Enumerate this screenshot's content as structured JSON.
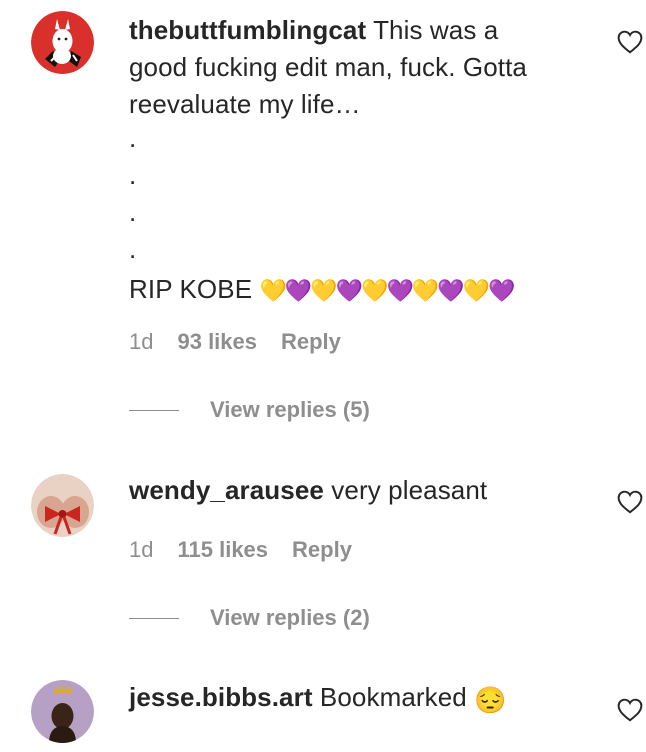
{
  "comments": [
    {
      "username": "thebuttfumblingcat",
      "text_line1": "This was a",
      "text_line2": "good fucking edit man, fuck. Gotta",
      "text_line3": "reevaluate my life…",
      "dots": [
        ".",
        ".",
        ".",
        "."
      ],
      "rip_text": "RIP KOBE",
      "hearts": "💛💜💛💜💛💜💛💜💛💜",
      "age": "1d",
      "likes": "93 likes",
      "reply_label": "Reply",
      "view_replies": "View replies (5)"
    },
    {
      "username": "wendy_arausee",
      "text": "very pleasant",
      "age": "1d",
      "likes": "115 likes",
      "reply_label": "Reply",
      "view_replies": "View replies (2)"
    },
    {
      "username": "jesse.bibbs.art",
      "text": "Bookmarked",
      "emoji": "😔"
    }
  ],
  "icons": {
    "like": "heart-outline-icon"
  },
  "colors": {
    "text": "#262626",
    "secondary": "#8e8e8e",
    "avatar1_bg": "#d9302b"
  }
}
